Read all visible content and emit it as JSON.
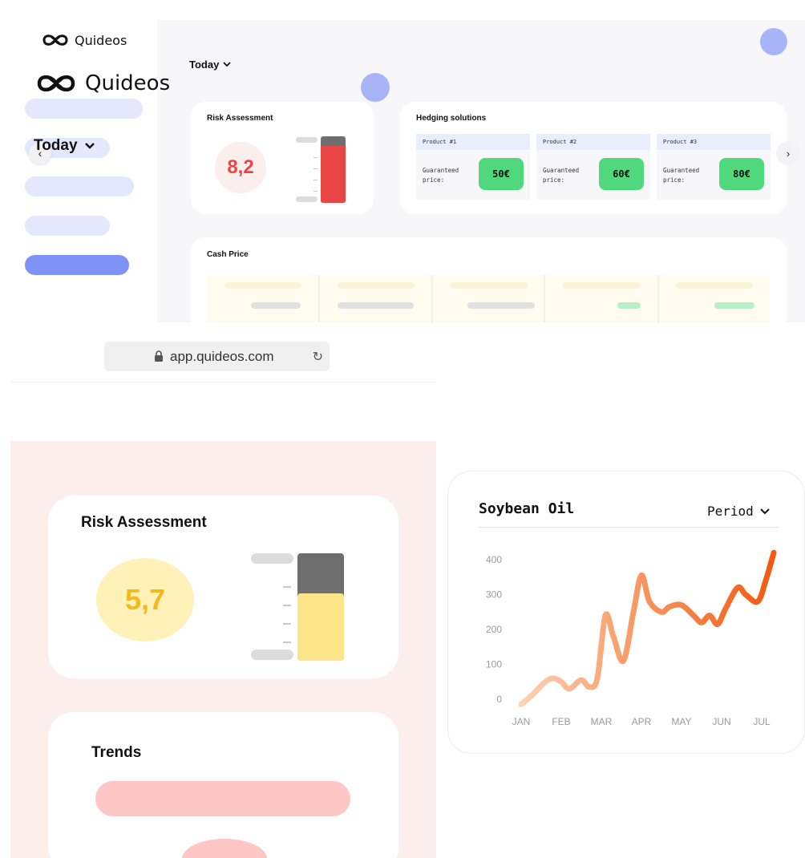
{
  "brand": {
    "name": "Quideos"
  },
  "desktop": {
    "today_label": "Today",
    "risk": {
      "title": "Risk Assessment",
      "score": "8,2",
      "level": 0.85
    },
    "hedging": {
      "title": "Hedging solutions",
      "products": [
        {
          "name": "Product #1",
          "label": "Guaranteed price:",
          "price": "50€"
        },
        {
          "name": "Product #2",
          "label": "Guaranteed price:",
          "price": "60€"
        },
        {
          "name": "Product #3",
          "label": "Guaranteed price:",
          "price": "80€"
        }
      ]
    },
    "cash": {
      "title": "Cash Price"
    },
    "colors": {
      "accent": "#7f92f6",
      "risk_high": "#e94545",
      "price_green": "#4fd97c"
    }
  },
  "mobile": {
    "url": "app.quideos.com",
    "today_label": "Today",
    "risk": {
      "title": "Risk Assessment",
      "score": "5,7",
      "level": 0.63
    },
    "trends": {
      "title": "Trends"
    },
    "colors": {
      "risk_mid": "#f3b91f",
      "background": "#fdeeee"
    }
  },
  "chart": {
    "title": "Soybean Oil",
    "period_label": "Period"
  },
  "chart_data": {
    "type": "line",
    "title": "Soybean Oil",
    "categories": [
      "JAN",
      "FEB",
      "MAR",
      "APR",
      "MAY",
      "JUN",
      "JUL"
    ],
    "yticks": [
      0,
      100,
      200,
      300,
      400
    ],
    "ylim": [
      0,
      400
    ],
    "grid": false,
    "series": [
      {
        "x": [
          0,
          0.3,
          0.6,
          0.8,
          1.0,
          1.2,
          1.5,
          1.7,
          1.9,
          2.1,
          2.3,
          2.55,
          2.8,
          3.0,
          3.2,
          3.5,
          3.7,
          4.0,
          4.3,
          4.5,
          4.7,
          4.9,
          5.1,
          5.4,
          5.6,
          5.9,
          6.1,
          6.3
        ],
        "y": [
          -15,
          15,
          50,
          60,
          50,
          30,
          55,
          35,
          60,
          240,
          180,
          110,
          250,
          355,
          280,
          250,
          265,
          270,
          240,
          220,
          240,
          215,
          260,
          320,
          300,
          280,
          340,
          420
        ]
      }
    ]
  }
}
